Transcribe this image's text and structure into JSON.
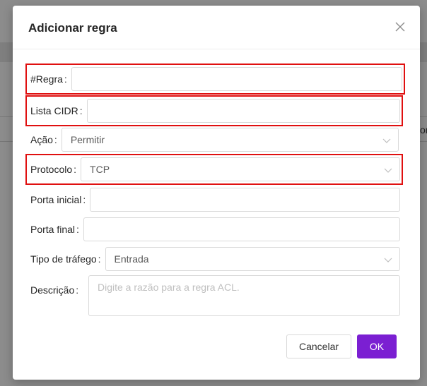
{
  "background": {
    "cut_text": "or"
  },
  "modal": {
    "title": "Adicionar regra",
    "close_icon": "close-icon"
  },
  "form": {
    "rule": {
      "label": "#Regra",
      "value": ""
    },
    "cidr": {
      "label": "Lista CIDR",
      "value": ""
    },
    "action": {
      "label": "Ação",
      "value": "Permitir"
    },
    "protocol": {
      "label": "Protocolo",
      "value": "TCP"
    },
    "port_start": {
      "label": "Porta inicial",
      "value": ""
    },
    "port_end": {
      "label": "Porta final",
      "value": ""
    },
    "traffic": {
      "label": "Tipo de tráfego",
      "value": "Entrada"
    },
    "description": {
      "label": "Descrição",
      "placeholder": "Digite a razão para a regra ACL."
    }
  },
  "footer": {
    "cancel_label": "Cancelar",
    "ok_label": "OK"
  },
  "colors": {
    "accent": "#7b1fd2",
    "highlight": "#e01010",
    "border": "#d9d9d9"
  }
}
